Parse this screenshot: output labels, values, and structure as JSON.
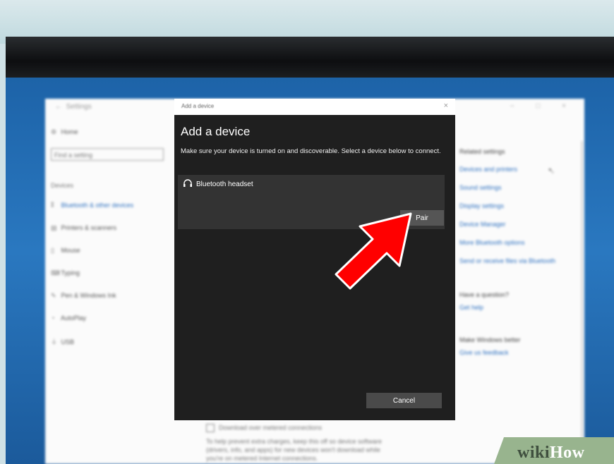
{
  "settings": {
    "window_title": "Settings",
    "window_controls": "– □ ×",
    "search_placeholder": "Find a setting",
    "home": "Home",
    "section": "Devices",
    "nav": [
      {
        "label": "Bluetooth & other devices",
        "icon": "bluetooth-icon",
        "active": true
      },
      {
        "label": "Printers & scanners",
        "icon": "printer-icon"
      },
      {
        "label": "Mouse",
        "icon": "mouse-icon"
      },
      {
        "label": "Typing",
        "icon": "keyboard-icon"
      },
      {
        "label": "Pen & Windows Ink",
        "icon": "pen-icon"
      },
      {
        "label": "AutoPlay",
        "icon": "autoplay-icon"
      },
      {
        "label": "USB",
        "icon": "usb-icon"
      }
    ],
    "related_heading": "Related settings",
    "related_links": [
      "Devices and printers",
      "Sound settings",
      "Display settings",
      "Device Manager",
      "More Bluetooth options",
      "Send or receive files via Bluetooth"
    ],
    "question_heading": "Have a question?",
    "get_help": "Get help",
    "better_heading": "Make Windows better",
    "feedback": "Give us feedback",
    "download_checkbox_label": "Download over metered connections",
    "download_desc": [
      "To help prevent extra charges, keep this off so device software",
      "(drivers, info, and apps) for new devices won't download while",
      "you're on metered Internet connections."
    ]
  },
  "dialog": {
    "window_title": "Add a device",
    "close_glyph": "×",
    "heading": "Add a device",
    "description": "Make sure your device is turned on and discoverable. Select a device below to connect.",
    "device_name": "Bluetooth headset",
    "device_icon": "headphones-icon",
    "pair_label": "Pair",
    "cancel_label": "Cancel"
  },
  "annotation": {
    "arrow_color": "#ff0000",
    "arrow_icon": "red-arrow-icon"
  },
  "watermark": {
    "brand_a": "wiki",
    "brand_b": "How"
  }
}
